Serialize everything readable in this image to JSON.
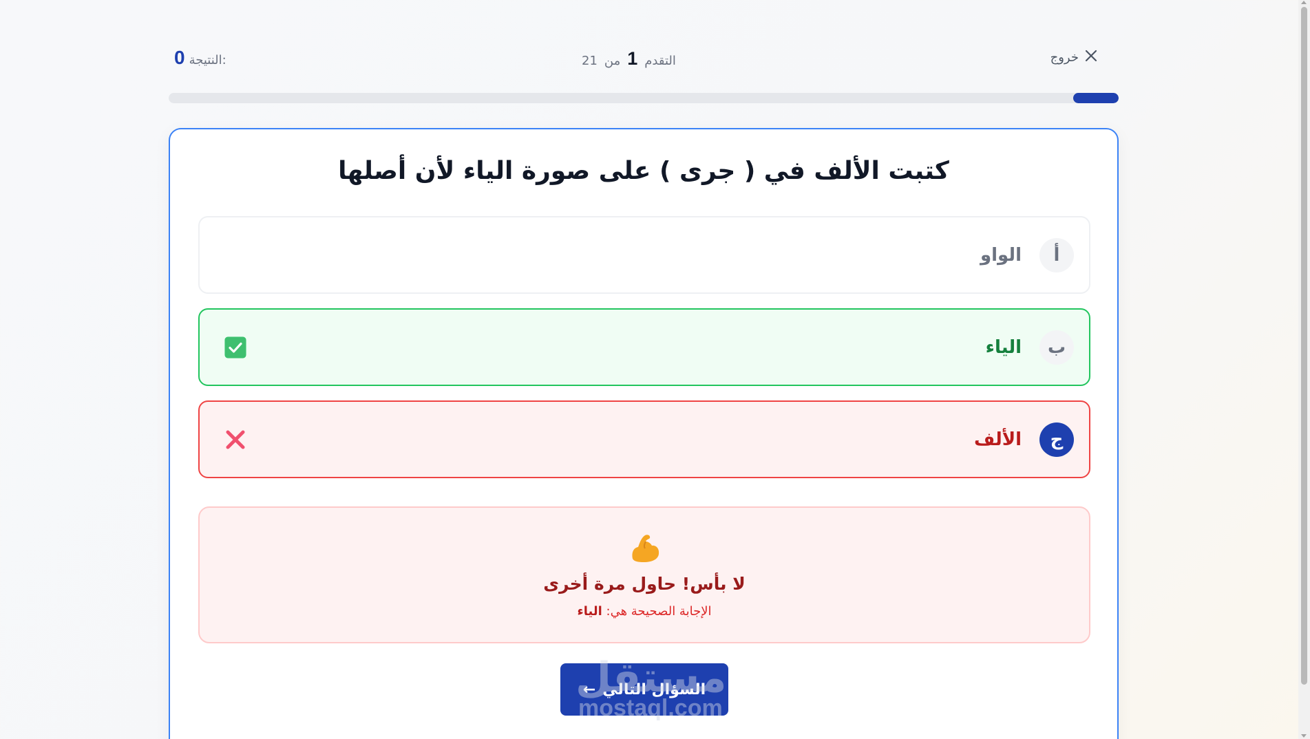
{
  "header": {
    "score_label": "النتيجة:",
    "score_value": "0",
    "progress_label": "التقدم",
    "progress_current": "1",
    "progress_of": "من",
    "progress_total": "21",
    "progress_fraction": 0.048,
    "exit_label": "خروج",
    "exit_icon": "close-icon"
  },
  "question": {
    "text": "كتبت الألف في ( جرى ) على صورة الياء لأن أصلها"
  },
  "options": [
    {
      "letter": "أ",
      "text": "الواو",
      "state": "neutral"
    },
    {
      "letter": "ب",
      "text": "الياء",
      "state": "correct",
      "icon": "check-icon"
    },
    {
      "letter": "ج",
      "text": "الألف",
      "state": "wrong-selected",
      "icon": "x-icon"
    }
  ],
  "feedback": {
    "icon": "flexed-biceps-emoji",
    "title": "لا بأس! حاول مرة أخرى",
    "answer_prefix": "الإجابة الصحيحة هي:",
    "answer_value": "الياء"
  },
  "next_button": {
    "label": "السؤال التالي",
    "arrow": "←"
  },
  "watermark": {
    "arabic": "مستقل",
    "latin": "mostaql.com"
  },
  "colors": {
    "accent": "#1e40af",
    "correct": "#22c55e",
    "wrong": "#ef4444"
  }
}
